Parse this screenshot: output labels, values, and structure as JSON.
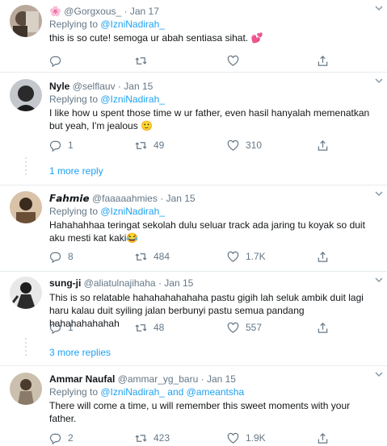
{
  "tweets": [
    {
      "display_name": "🌸",
      "handle": "@Gorgxous_",
      "date": "Jan 17",
      "replying_prefix": "Replying to ",
      "replying_to": "@IzniNadirah_",
      "replying_join": "",
      "replying_to_2": "",
      "text": "this is so cute! semoga ur abah sentiasa sihat. 💕",
      "replies": "",
      "retweets": "",
      "likes": ""
    },
    {
      "display_name": "Nyle",
      "handle": "@selflauv",
      "date": "Jan 15",
      "replying_prefix": "Replying to ",
      "replying_to": "@IzniNadirah_",
      "replying_join": "",
      "replying_to_2": "",
      "text": "I like how u spent those time w ur father, even hasil hanyalah memenatkan but yeah, I'm jealous 🙂",
      "replies": "1",
      "retweets": "49",
      "likes": "310"
    },
    {
      "display_name": "𝙁𝙖𝙝𝙢𝙞𝙚",
      "handle": "@faaaaahmies",
      "date": "Jan 15",
      "replying_prefix": "Replying to ",
      "replying_to": "@IzniNadirah_",
      "replying_join": "",
      "replying_to_2": "",
      "text": "Hahahahhaa teringat sekolah dulu seluar track ada jaring tu koyak so duit aku mesti kat kaki😂",
      "replies": "8",
      "retweets": "484",
      "likes": "1.7K"
    },
    {
      "display_name": "sung-ji",
      "handle": "@aliatulnajihaha",
      "date": "Jan 15",
      "replying_prefix": "",
      "replying_to": "",
      "replying_join": "",
      "replying_to_2": "",
      "text": "This is so relatable hahahahahahaha pastu gigih lah seluk ambik duit lagi haru kalau duit syiling jalan berbunyi pastu semua pandang hahahahahahah",
      "replies": "1",
      "retweets": "48",
      "likes": "557"
    },
    {
      "display_name": "Ammar Naufal",
      "handle": "@ammar_yg_baru",
      "date": "Jan 15",
      "replying_prefix": "Replying to ",
      "replying_to": "@IzniNadirah_",
      "replying_join": " and ",
      "replying_to_2": "@ameantsha",
      "text": "There will come a time, u will remember this sweet moments with your father.",
      "replies": "2",
      "retweets": "423",
      "likes": "1.9K"
    }
  ],
  "more_replies": [
    {
      "label": "1 more reply"
    },
    {
      "label": "3 more replies"
    }
  ],
  "separator_dot": "·",
  "colors": {
    "link": "#1da1f2",
    "secondary": "#657786",
    "border": "#e6ecf0"
  },
  "icons": [
    "reply-icon",
    "retweet-icon",
    "like-icon",
    "share-icon",
    "chevron-down-icon"
  ]
}
